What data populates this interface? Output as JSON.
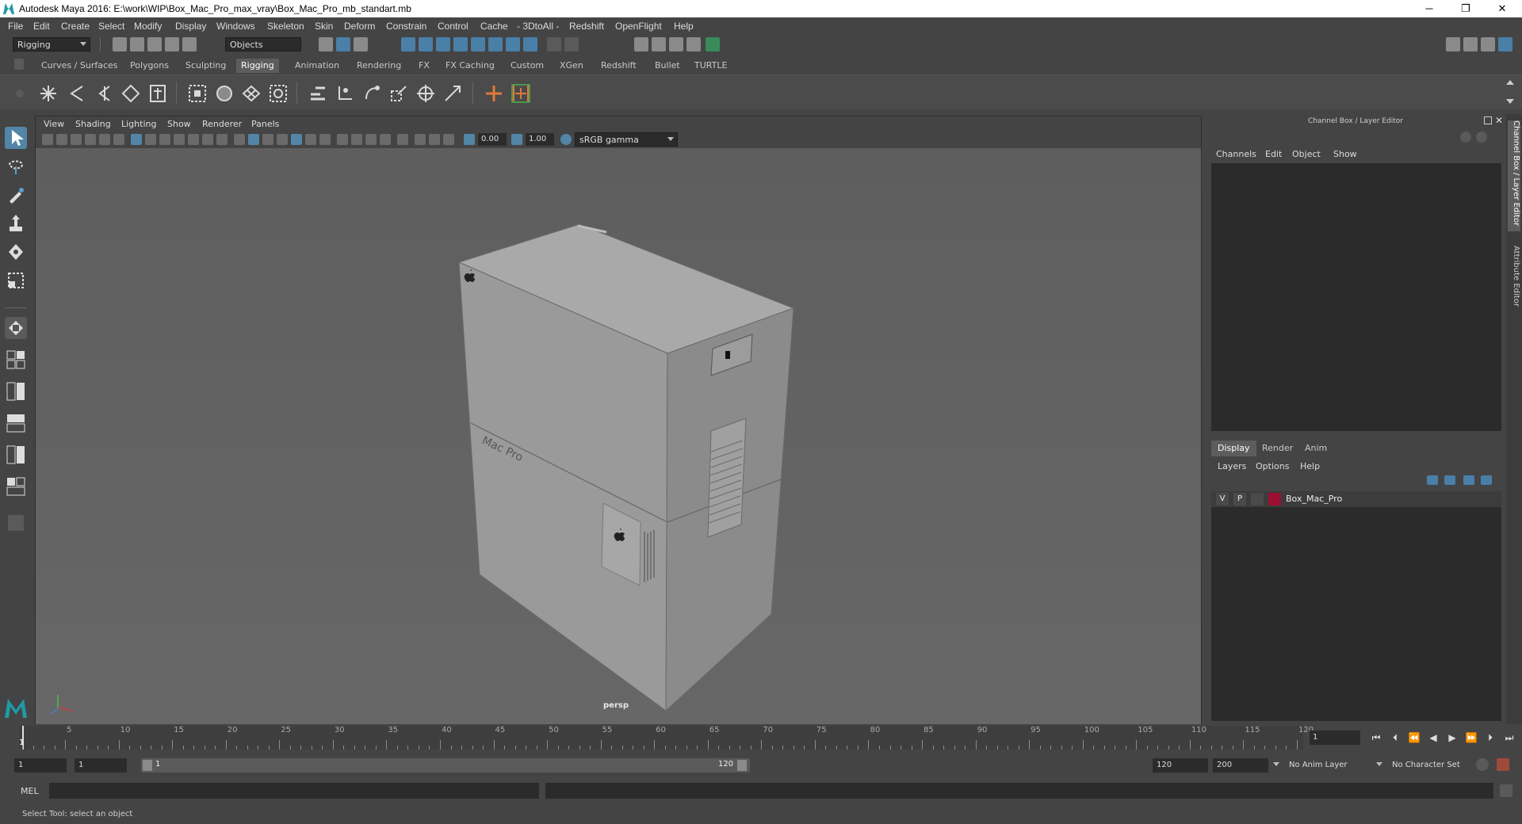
{
  "window": {
    "title": "Autodesk Maya 2016: E:\\work\\WIP\\Box_Mac_Pro_max_vray\\Box_Mac_Pro_mb_standart.mb",
    "minimize": "─",
    "restore": "❐",
    "close": "✕"
  },
  "menubar": [
    "File",
    "Edit",
    "Create",
    "Select",
    "Modify",
    "Display",
    "Windows",
    "Skeleton",
    "Skin",
    "Deform",
    "Constrain",
    "Control",
    "Cache",
    "- 3DtoAll -",
    "Redshift",
    "OpenFlight",
    "Help"
  ],
  "statusline": {
    "mode": "Rigging",
    "selection_mask": "Objects"
  },
  "shelf_tabs": [
    "Curves / Surfaces",
    "Polygons",
    "Sculpting",
    "Rigging",
    "Animation",
    "Rendering",
    "FX",
    "FX Caching",
    "Custom",
    "XGen",
    "Redshift",
    "Bullet",
    "TURTLE"
  ],
  "active_shelf": "Rigging",
  "viewport": {
    "menus": [
      "View",
      "Shading",
      "Lighting",
      "Show",
      "Renderer",
      "Panels"
    ],
    "exposure": "0.00",
    "gamma": "1.00",
    "color_space": "sRGB gamma",
    "camera_label": "persp",
    "object_brand_text": "Mac Pro"
  },
  "channel_box": {
    "title": "Channel Box / Layer Editor",
    "menus": [
      "Channels",
      "Edit",
      "Object",
      "Show"
    ],
    "layer_tabs": [
      "Display",
      "Render",
      "Anim"
    ],
    "active_layer_tab": "Display",
    "layer_menus": [
      "Layers",
      "Options",
      "Help"
    ],
    "layers": [
      {
        "visible": "V",
        "playback": "P",
        "name": "Box_Mac_Pro",
        "color": "#9a1030"
      }
    ]
  },
  "side_tabs": [
    "Channel Box / Layer Editor",
    "Attribute Editor"
  ],
  "time_slider": {
    "ticks": [
      "5",
      "10",
      "15",
      "20",
      "25",
      "30",
      "35",
      "40",
      "45",
      "50",
      "55",
      "60",
      "65",
      "70",
      "75",
      "80",
      "85",
      "90",
      "95",
      "100",
      "105",
      "110",
      "115",
      "120"
    ],
    "start_marker": "1",
    "current_frame": "1"
  },
  "range": {
    "start": "1",
    "anim_start": "1",
    "range_start": "1",
    "range_end": "120",
    "end": "120",
    "anim_end": "200",
    "anim_layer": "No Anim Layer",
    "character_set": "No Character Set"
  },
  "command_line": {
    "label": "MEL"
  },
  "help_line": {
    "text": "Select Tool: select an object"
  },
  "colors": {
    "accent": "#5285a6",
    "layer_color": "#9a1030"
  }
}
